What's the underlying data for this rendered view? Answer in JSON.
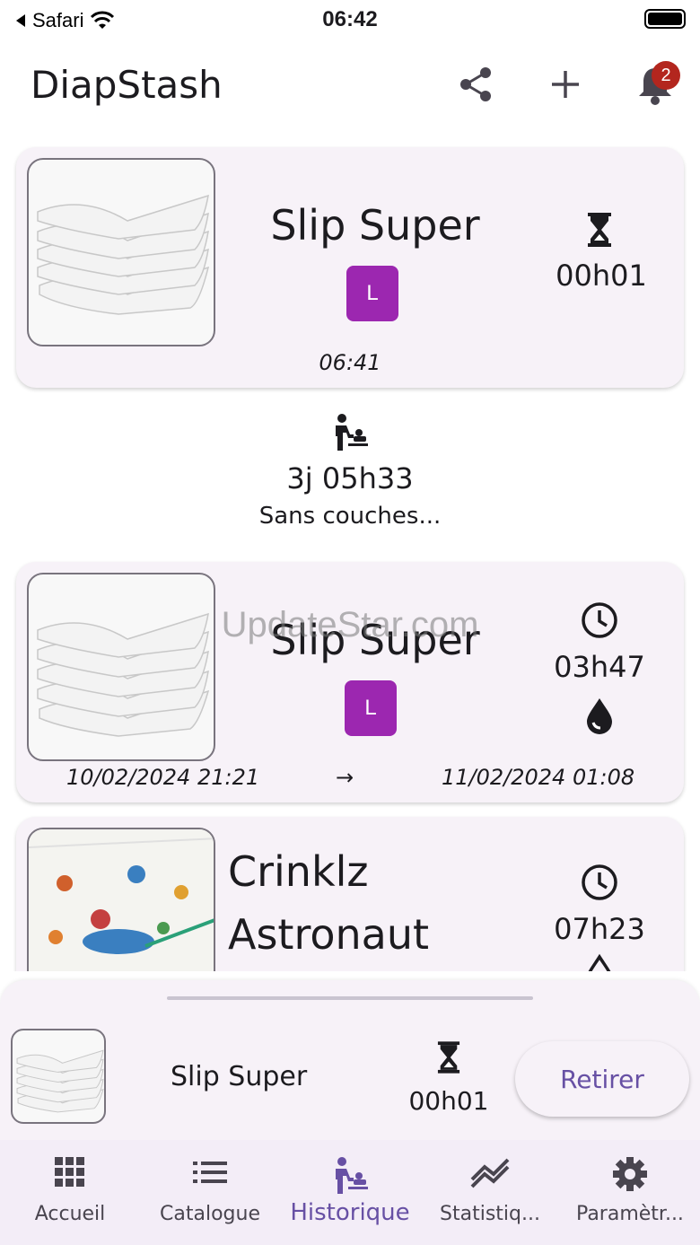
{
  "status_bar": {
    "back_label": "Safari",
    "time": "06:42"
  },
  "app_bar": {
    "title": "DiapStash",
    "notification_count": "2",
    "icons": [
      "share-icon",
      "add-icon",
      "bell-icon"
    ]
  },
  "current_card": {
    "name": "Slip Super",
    "size": "L",
    "duration": "00h01",
    "time": "06:41",
    "icon": "hourglass-icon"
  },
  "gap": {
    "duration": "3j 05h33",
    "label": "Sans couches..."
  },
  "watermark": "UpdateStar.com",
  "history": [
    {
      "name": "Slip Super",
      "size": "L",
      "duration": "03h47",
      "start": "10/02/2024 21:21",
      "arrow": "→",
      "end": "11/02/2024 01:08",
      "status_icon": "wet-drop-icon"
    },
    {
      "name": "Crinklz Astronaut",
      "duration": "07h23"
    }
  ],
  "sheet": {
    "name": "Slip Super",
    "duration": "00h01",
    "button": "Retirer"
  },
  "nav": [
    {
      "label": "Accueil",
      "icon": "grid-icon"
    },
    {
      "label": "Catalogue",
      "icon": "list-icon"
    },
    {
      "label": "Historique",
      "icon": "changing-table-icon"
    },
    {
      "label": "Statistiq...",
      "icon": "chart-icon"
    },
    {
      "label": "Paramètr...",
      "icon": "gear-icon"
    }
  ],
  "colors": {
    "accent": "#6750a4",
    "size_chip": "#9c27b0",
    "badge": "#b3261e",
    "card_bg": "#f7f2f8"
  }
}
